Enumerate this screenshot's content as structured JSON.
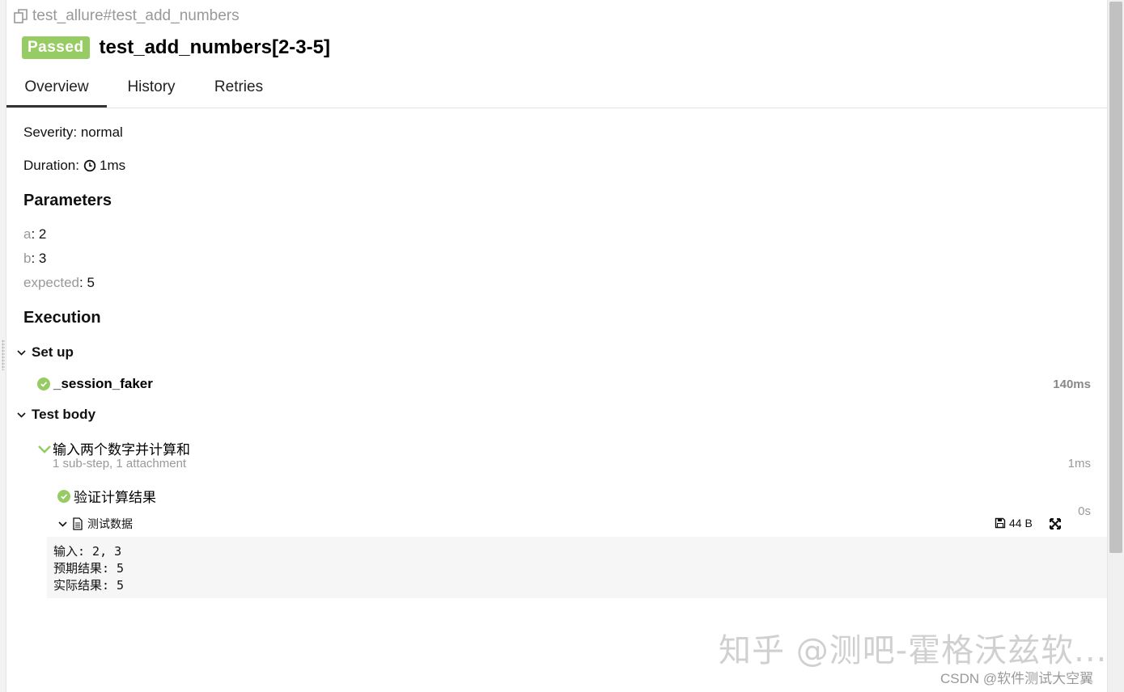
{
  "breadcrumb": {
    "text": "test_allure#test_add_numbers",
    "icon": "copy-icon"
  },
  "header": {
    "status": "Passed",
    "title": "test_add_numbers[2-3-5]",
    "status_color": "#97cc64"
  },
  "tabs": [
    {
      "label": "Overview",
      "active": true
    },
    {
      "label": "History",
      "active": false
    },
    {
      "label": "Retries",
      "active": false
    }
  ],
  "overview": {
    "severity": "Severity: normal",
    "duration_label": "Duration:",
    "duration_value": "1ms",
    "parameters_title": "Parameters",
    "parameters": [
      {
        "key": "a",
        "value": "2"
      },
      {
        "key": "b",
        "value": "3"
      },
      {
        "key": "expected",
        "value": "5"
      }
    ],
    "execution_title": "Execution"
  },
  "execution": {
    "setup": {
      "label": "Set up",
      "steps": [
        {
          "name": "_session_faker",
          "duration": "140ms"
        }
      ]
    },
    "test_body": {
      "label": "Test body",
      "step": {
        "name": "输入两个数字并计算和",
        "summary": "1 sub-step, 1 attachment",
        "duration": "1ms",
        "substep": {
          "name": "验证计算结果",
          "duration": "0s"
        },
        "attachment": {
          "name": "测试数据",
          "size": "44 B",
          "lines": [
            "输入: 2, 3",
            "预期结果: 5",
            "实际结果: 5"
          ]
        }
      }
    }
  },
  "watermark": {
    "text": "知乎 @测吧-霍格沃兹软...",
    "csdn": "CSDN @软件测试大空翼"
  }
}
